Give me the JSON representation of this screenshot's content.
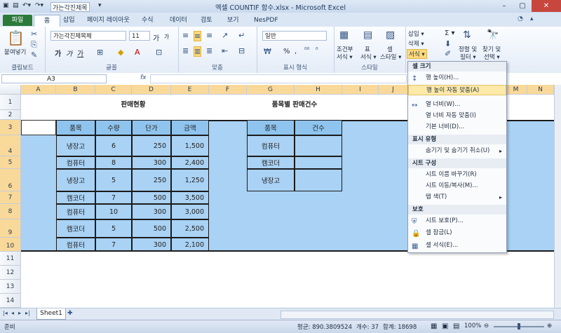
{
  "window": {
    "title": "엑셀 COUNTIF 함수.xlsx - Microsoft Excel",
    "quick_font": "가는각진제목"
  },
  "tabs": [
    "파일",
    "홈",
    "삽입",
    "페이지 레이아웃",
    "수식",
    "데이터",
    "검토",
    "보기",
    "NesPDF"
  ],
  "ribbon": {
    "clipboard": {
      "paste": "붙여넣기",
      "label": "클립보드"
    },
    "font": {
      "name": "가는각진제목체",
      "size": "11",
      "label": "글꼴",
      "bold": "가",
      "italic": "가",
      "underline": "가",
      "grow": "가",
      "shrink": "가"
    },
    "align": {
      "label": "맞춤"
    },
    "number": {
      "format": "일반",
      "label": "표시 형식",
      "percent": "%",
      "comma": ","
    },
    "styles": {
      "cond": "조건부",
      "cond2": "서식 ▾",
      "table": "표",
      "table2": "서식 ▾",
      "cell": "셀",
      "cell2": "스타일 ▾",
      "label": "스타일"
    },
    "cells": {
      "insert": "삽입 ▾",
      "delete": "삭제 ▾",
      "format": "서식 ▾"
    },
    "editing": {
      "sort": "정렬 및",
      "sort2": "필터 ▾",
      "find": "찾기 및",
      "find2": "선택 ▾",
      "sigma": "Σ ▾"
    }
  },
  "formula_bar": {
    "name_box": "A3",
    "fx": "fx"
  },
  "columns": [
    "A",
    "B",
    "C",
    "D",
    "E",
    "F",
    "G",
    "H",
    "I",
    "J",
    "K",
    "L",
    "M",
    "N"
  ],
  "rows": [
    "1",
    "2",
    "3",
    "4",
    "5",
    "6",
    "7",
    "8",
    "9",
    "10",
    "11",
    "12",
    "13",
    "14"
  ],
  "sheet": {
    "title_left": "판매현황",
    "title_right": "품목별 판매건수",
    "table1_headers": [
      "품목",
      "수량",
      "단가",
      "금액"
    ],
    "table1_rows": [
      [
        "냉장고",
        "6",
        "250",
        "1,500"
      ],
      [
        "컴퓨터",
        "8",
        "300",
        "2,400"
      ],
      [
        "냉장고",
        "5",
        "250",
        "1,250"
      ],
      [
        "캠코더",
        "7",
        "500",
        "3,500"
      ],
      [
        "컴퓨터",
        "10",
        "300",
        "3,000"
      ],
      [
        "캠코더",
        "5",
        "500",
        "2,500"
      ],
      [
        "컴퓨터",
        "7",
        "300",
        "2,100"
      ]
    ],
    "table2_headers": [
      "품목",
      "건수"
    ],
    "table2_rows": [
      [
        "컴퓨터",
        ""
      ],
      [
        "캠코더",
        ""
      ],
      [
        "냉장고",
        ""
      ]
    ]
  },
  "menu": {
    "sections": [
      {
        "title": "셀 크기",
        "items": [
          {
            "icon": "row-height-icon",
            "label": "행 높이(H)...",
            "arrow": ""
          },
          {
            "icon": "",
            "label": "행 높이 자동 맞춤(A)",
            "arrow": "",
            "highlight": true
          },
          {
            "icon": "column-width-icon",
            "label": "열 너비(W)...",
            "arrow": ""
          },
          {
            "icon": "",
            "label": "열 너비 자동 맞춤(I)",
            "arrow": ""
          },
          {
            "icon": "",
            "label": "기본 너비(D)...",
            "arrow": ""
          }
        ]
      },
      {
        "title": "표시 유형",
        "items": [
          {
            "icon": "",
            "label": "숨기기 및 숨기기 취소(U)",
            "arrow": "▸"
          }
        ]
      },
      {
        "title": "시트 구성",
        "items": [
          {
            "icon": "",
            "label": "시트 이름 바꾸기(R)",
            "arrow": ""
          },
          {
            "icon": "",
            "label": "시트 이동/복사(M)...",
            "arrow": ""
          },
          {
            "icon": "",
            "label": "탭 색(T)",
            "arrow": "▸"
          }
        ]
      },
      {
        "title": "보호",
        "items": [
          {
            "icon": "protect-sheet-icon",
            "label": "시트 보호(P)...",
            "arrow": ""
          },
          {
            "icon": "lock-icon",
            "label": "셀 잠금(L)",
            "arrow": ""
          },
          {
            "icon": "format-cells-icon",
            "label": "셀 서식(E)...",
            "arrow": ""
          }
        ]
      }
    ]
  },
  "sheet_tab": "Sheet1",
  "status": {
    "mode": "준비",
    "average": "평균: 890.3809524",
    "count": "개수: 37",
    "sum": "합계: 18698",
    "zoom": "100%"
  }
}
